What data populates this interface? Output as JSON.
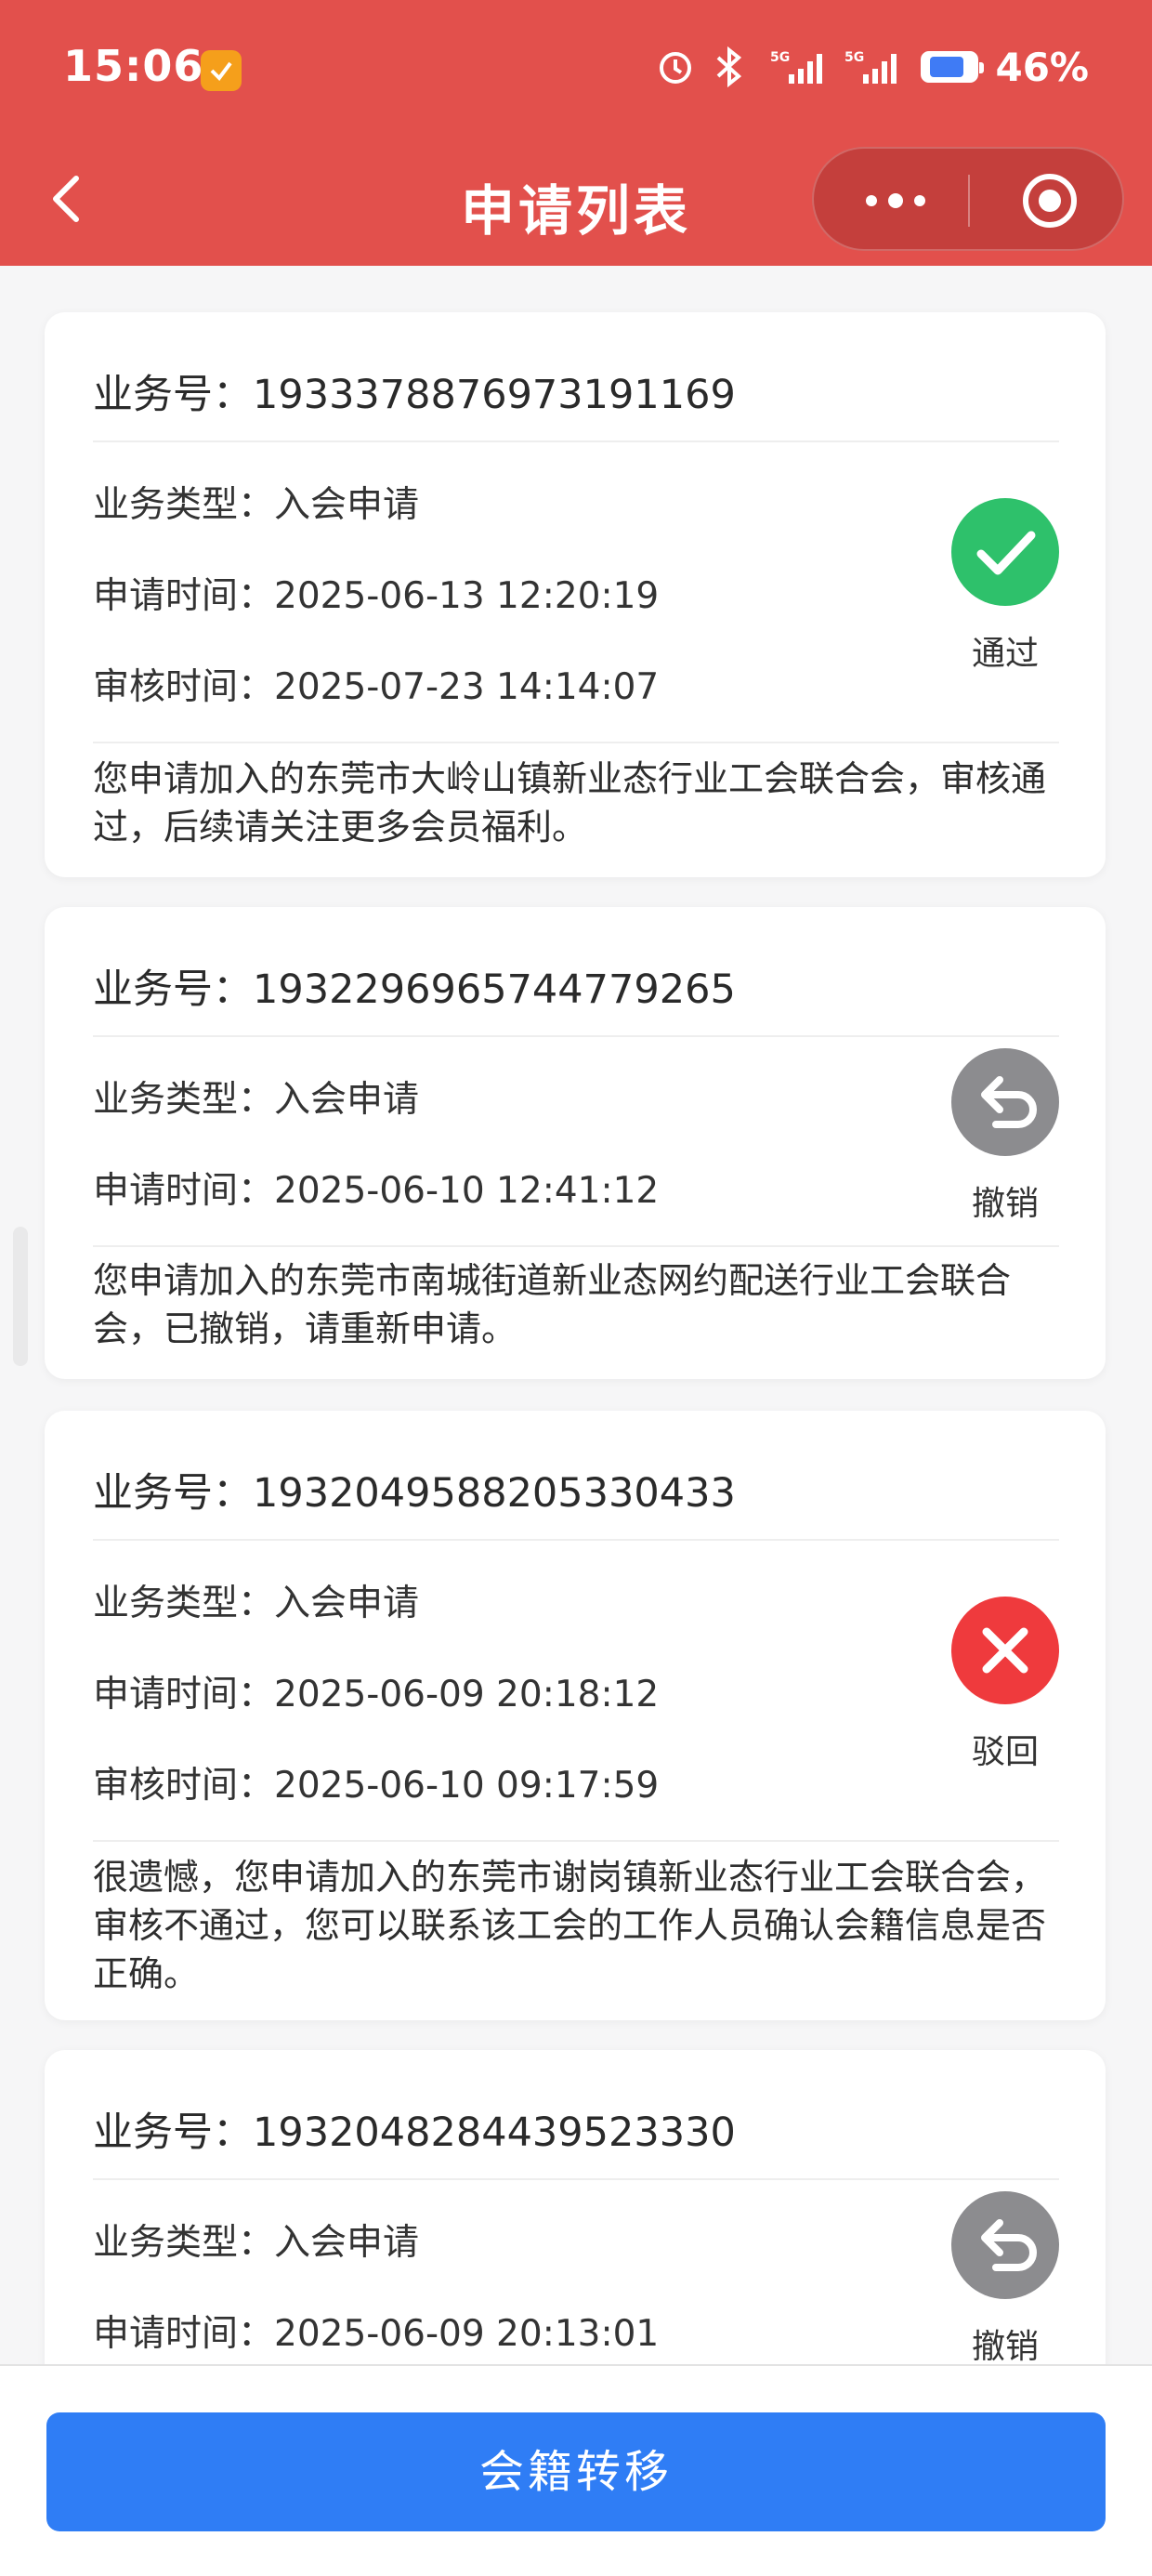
{
  "status_bar": {
    "time": "15:06",
    "network": "5G",
    "battery": "46%"
  },
  "header": {
    "title": "申请列表",
    "more_icon": "more-dots-icon",
    "close_icon": "target-circle-icon"
  },
  "labels": {
    "business_no": "业务号：",
    "business_type": "业务类型：",
    "apply_time": "申请时间：",
    "review_time": "审核时间："
  },
  "applications": [
    {
      "business_no": "1933378876973191169",
      "business_type": "入会申请",
      "apply_time": "2025-06-13 12:20:19",
      "review_time": "2025-07-23 14:14:07",
      "message": "您申请加入的东莞市大岭山镇新业态行业工会联合会，审核通过，后续请关注更多会员福利。",
      "status": "通过",
      "status_icon": "check-icon",
      "status_color": "#2ec16b"
    },
    {
      "business_no": "1932296965744779265",
      "business_type": "入会申请",
      "apply_time": "2025-06-10 12:41:12",
      "message": "您申请加入的东莞市南城街道新业态网约配送行业工会联合会，已撤销，请重新申请。",
      "status": "撤销",
      "status_icon": "undo-arrow-icon",
      "status_color": "#8c8c8f"
    },
    {
      "business_no": "1932049588205330433",
      "business_type": "入会申请",
      "apply_time": "2025-06-09 20:18:12",
      "review_time": "2025-06-10 09:17:59",
      "message": "很遗憾，您申请加入的东莞市谢岗镇新业态行业工会联合会，审核不通过，您可以联系该工会的工作人员确认会籍信息是否正确。",
      "status": "驳回",
      "status_icon": "x-icon",
      "status_color": "#ef3a3d"
    },
    {
      "business_no": "1932048284439523330",
      "business_type": "入会申请",
      "apply_time": "2025-06-09 20:13:01",
      "status": "撤销",
      "status_icon": "undo-arrow-icon",
      "status_color": "#8c8c8f"
    }
  ],
  "bottom": {
    "transfer_button": "会籍转移",
    "button_color": "#2f7df5"
  }
}
